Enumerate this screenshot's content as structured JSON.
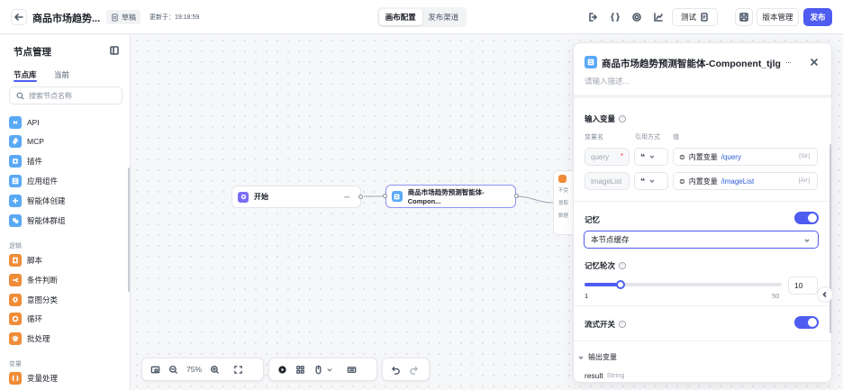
{
  "header": {
    "title": "商品市场趋势...",
    "draft_label": "草稿",
    "updated_text": "更新于：19:18:59",
    "tabs": [
      {
        "label": "画布配置",
        "active": true
      },
      {
        "label": "发布渠道",
        "active": false
      }
    ],
    "test_label": "测试",
    "version_label": "版本管理",
    "publish_label": "发布",
    "accent_color": "#4e5cf0"
  },
  "sidebar": {
    "title": "节点管理",
    "tabs": [
      {
        "label": "节点库",
        "active": true
      },
      {
        "label": "当前",
        "active": false
      }
    ],
    "search_placeholder": "搜索节点名称",
    "groups": [
      {
        "items": [
          {
            "label": "API",
            "icon": "api-icon"
          },
          {
            "label": "MCP",
            "icon": "mcp-icon"
          },
          {
            "label": "插件",
            "icon": "plugin-icon"
          },
          {
            "label": "应用组件",
            "icon": "component-icon"
          },
          {
            "label": "智能体创建",
            "icon": "agent-create-icon"
          },
          {
            "label": "智能体群组",
            "icon": "agent-group-icon"
          }
        ]
      },
      {
        "title": "逻辑",
        "items": [
          {
            "label": "脚本",
            "icon": "script-icon"
          },
          {
            "label": "条件判断",
            "icon": "condition-icon"
          },
          {
            "label": "意图分类",
            "icon": "intent-icon"
          },
          {
            "label": "循环",
            "icon": "loop-icon"
          },
          {
            "label": "批处理",
            "icon": "batch-icon"
          }
        ]
      },
      {
        "title": "变量",
        "items": [
          {
            "label": "变量处理",
            "icon": "variable-icon"
          }
        ]
      }
    ]
  },
  "canvas": {
    "start_node": "开始",
    "component_node": "商品市场趋势预测智能体-Compon...",
    "partial_node_lines": [
      "不受",
      "提取",
      "数据"
    ],
    "zoom": "75%"
  },
  "panel": {
    "title": "商品市场趋势预测智能体-Component_tjlg",
    "desc_placeholder": "请输入描述...",
    "input_section": "输入变量",
    "col_name": "变量名",
    "col_ref": "引用方式",
    "col_value": "值",
    "inputs": [
      {
        "name": "query",
        "required": true,
        "ref": "",
        "value_prefix": "内置变量",
        "value_path": "/query",
        "type_tag": "[Str]"
      },
      {
        "name": "imageList",
        "required": false,
        "ref": "",
        "value_prefix": "内置变量",
        "value_path": "/imageList",
        "type_tag": "[Arr]"
      }
    ],
    "memory_label": "记忆",
    "memory_enabled": true,
    "memory_select": "本节点缓存",
    "memory_rounds_label": "记忆轮次",
    "memory_rounds_value": "10",
    "slider_min": "1",
    "slider_max": "50",
    "slider_value": 10,
    "stream_label": "流式开关",
    "stream_enabled": true,
    "output_section": "输出变量",
    "outputs": [
      {
        "name": "result",
        "type": "String"
      }
    ]
  }
}
